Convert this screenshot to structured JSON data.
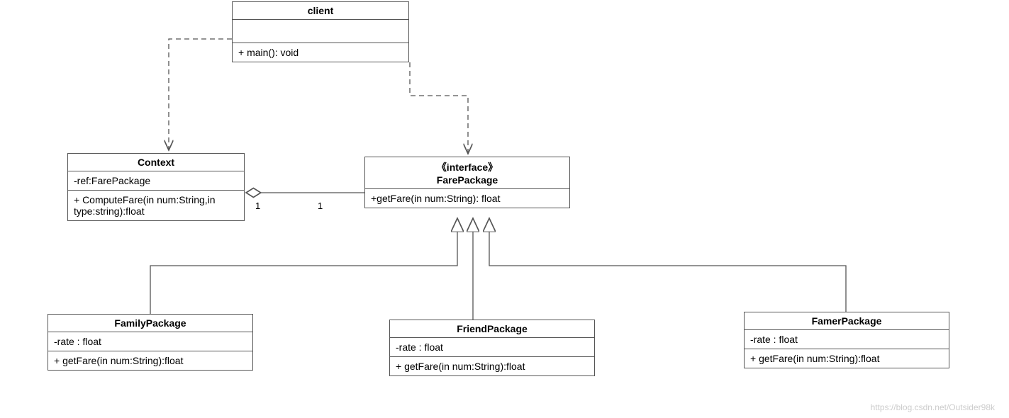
{
  "client": {
    "name": "client",
    "op": "+ main():  void"
  },
  "context": {
    "name": "Context",
    "attr": "-ref:FarePackage",
    "op": "+ ComputeFare(in num:String,in type:string):float"
  },
  "farepackage": {
    "stereo": "《interface》",
    "name": "FarePackage",
    "op": "+getFare(in num:String): float"
  },
  "family": {
    "name": "FamilyPackage",
    "attr": "-rate : float",
    "op": "+ getFare(in num:String):float"
  },
  "friend": {
    "name": "FriendPackage",
    "attr": "-rate : float",
    "op": "+ getFare(in num:String):float"
  },
  "famer": {
    "name": "FamerPackage",
    "attr": "-rate : float",
    "op": "+ getFare(in num:String):float"
  },
  "mult": {
    "left": "1",
    "right": "1"
  },
  "watermark": "https://blog.csdn.net/Outsider98k"
}
